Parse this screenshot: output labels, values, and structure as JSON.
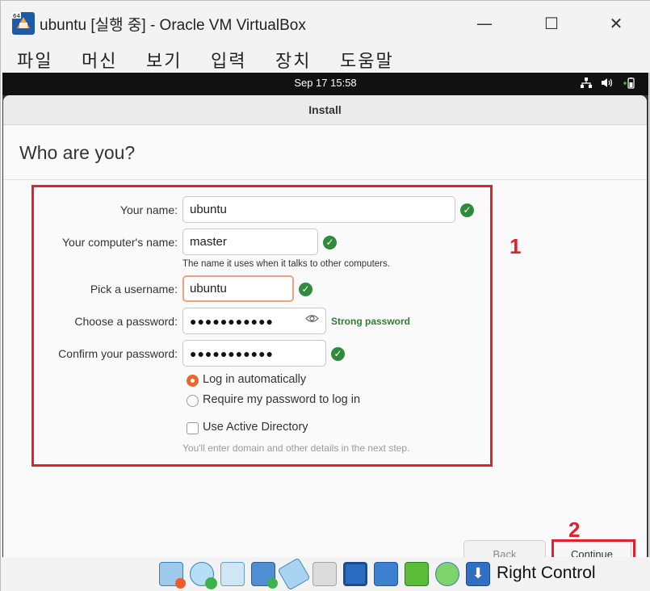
{
  "window": {
    "title": "ubuntu [실행 중] - Oracle VM VirtualBox",
    "minimize": "—",
    "maximize": "☐",
    "close": "✕",
    "badge": "64"
  },
  "menu": [
    "파일",
    "머신",
    "보기",
    "입력",
    "장치",
    "도움말"
  ],
  "guest_topbar": {
    "clock": "Sep 17  15:58",
    "icons": [
      "network-icon",
      "volume-icon",
      "battery-icon"
    ]
  },
  "installer": {
    "header": "Install",
    "page_title": "Who are you?",
    "fields": {
      "name_label": "Your name:",
      "name_value": "ubuntu",
      "computer_label": "Your computer's name:",
      "computer_value": "master",
      "computer_hint": "The name it uses when it talks to other computers.",
      "username_label": "Pick a username:",
      "username_value": "ubuntu",
      "password_label": "Choose a password:",
      "password_value": "●●●●●●●●●●●",
      "password_strength": "Strong password",
      "confirm_label": "Confirm your password:",
      "confirm_value": "●●●●●●●●●●●"
    },
    "options": {
      "login_auto": "Log in automatically",
      "login_require": "Require my password to log in",
      "selected": "login_auto",
      "active_directory": "Use Active Directory",
      "active_directory_checked": false,
      "ad_hint": "You'll enter domain and other details in the next step."
    },
    "buttons": {
      "back": "Back",
      "continue": "Continue"
    }
  },
  "annotations": {
    "box1": "1",
    "box2": "2"
  },
  "statusbar": {
    "host_key": "Right Control",
    "icons": [
      "hard-disk-icon",
      "optical-disk-icon",
      "audio-icon",
      "network-icon",
      "usb-icon",
      "shared-folder-icon",
      "display-icon",
      "recording-icon",
      "cpu-icon",
      "mouse-integration-icon",
      "host-key-icon"
    ]
  },
  "colors": {
    "accent": "#e9672f",
    "annotation": "#e3202c",
    "success": "#2f8a3b"
  }
}
